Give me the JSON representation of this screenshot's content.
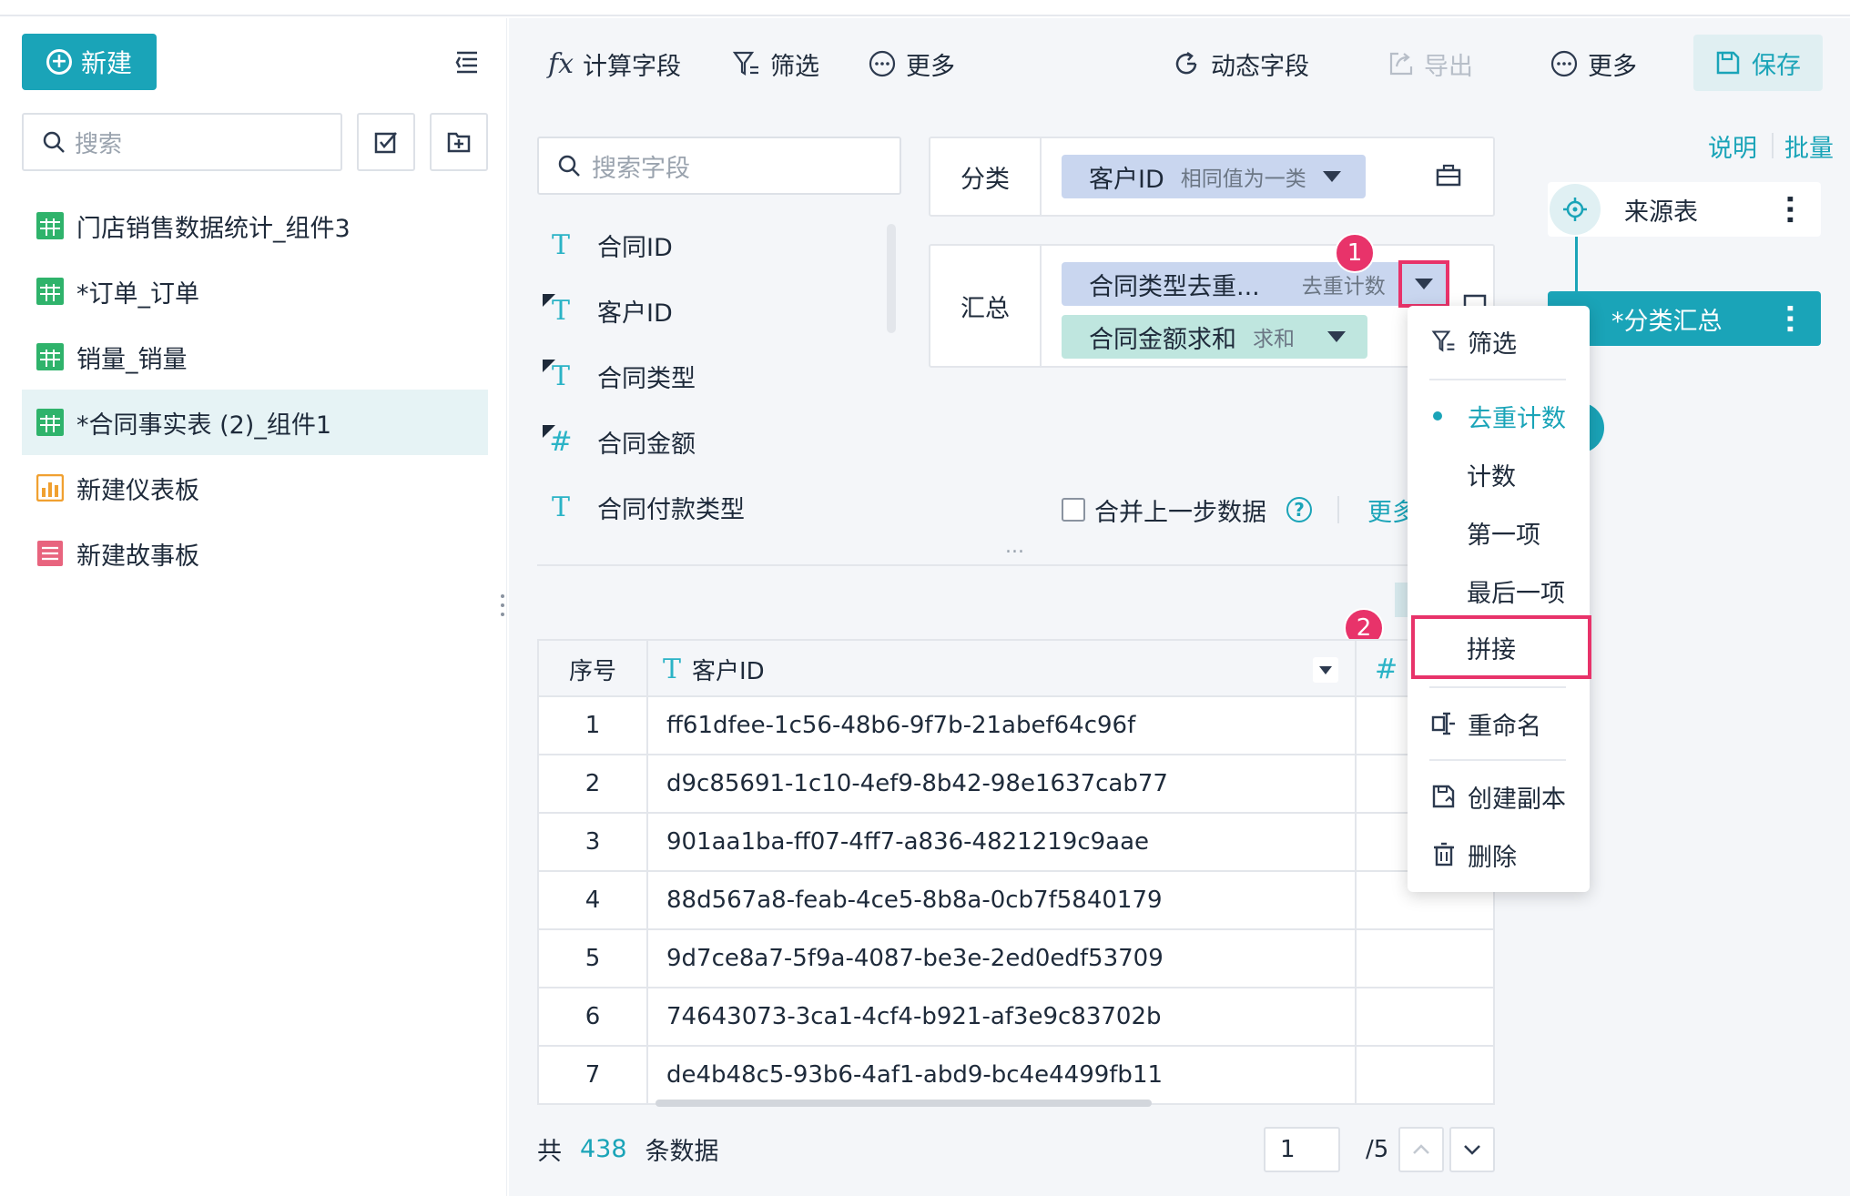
{
  "sidebar": {
    "new_label": "新建",
    "search_placeholder": "搜索",
    "items": [
      {
        "label": "门店销售数据统计_组件3",
        "icon": "table-icon",
        "color": "#2fb36b"
      },
      {
        "label": "*订单_订单",
        "icon": "table-icon",
        "color": "#2fb36b"
      },
      {
        "label": "销量_销量",
        "icon": "table-icon",
        "color": "#2fb36b"
      },
      {
        "label": "*合同事实表 (2)_组件1",
        "icon": "table-icon",
        "color": "#2fb36b"
      },
      {
        "label": "新建仪表板",
        "icon": "dashboard-icon",
        "color": "#f0a030"
      },
      {
        "label": "新建故事板",
        "icon": "story-icon",
        "color": "#e8647e"
      }
    ]
  },
  "toolbar": {
    "calc_field": "计算字段",
    "filter": "筛选",
    "more_left": "更多",
    "dynamic_field": "动态字段",
    "export": "导出",
    "more_right": "更多",
    "save": "保存"
  },
  "fields": {
    "search_placeholder": "搜索字段",
    "items": [
      {
        "label": "合同ID",
        "type": "T"
      },
      {
        "label": "客户ID",
        "type": "T"
      },
      {
        "label": "合同类型",
        "type": "T"
      },
      {
        "label": "合同金额",
        "type": "#"
      },
      {
        "label": "合同付款类型",
        "type": "T"
      }
    ]
  },
  "config": {
    "category_label": "分类",
    "category_pill": {
      "name": "客户ID",
      "sub": "相同值为一类"
    },
    "summary_label": "汇总",
    "summary_pills": [
      {
        "name": "合同类型去重...",
        "sub": "去重计数"
      },
      {
        "name": "合同金额求和",
        "sub": "求和"
      }
    ],
    "merge_prev": "合并上一步数据",
    "more_link": "更多",
    "badge1": "1",
    "badge2": "2",
    "ellipsis": "..."
  },
  "table": {
    "headers": [
      "序号",
      "客户ID",
      "#"
    ],
    "rows": [
      [
        "1",
        "ff61dfee-1c56-48b6-9f7b-21abef64c96f"
      ],
      [
        "2",
        "d9c85691-1c10-4ef9-8b42-98e1637cab77"
      ],
      [
        "3",
        "901aa1ba-ff07-4ff7-a836-4821219c9aae"
      ],
      [
        "4",
        "88d567a8-feab-4ce5-8b8a-0cb7f5840179"
      ],
      [
        "5",
        "9d7ce8a7-5f9a-4087-be3e-2ed0edf53709"
      ],
      [
        "6",
        "74643073-3ca1-4cf4-b921-af3e9c83702b"
      ],
      [
        "7",
        "de4b48c5-93b6-4af1-abd9-bc4e4499fb11"
      ]
    ]
  },
  "footer": {
    "prefix": "共",
    "count": "438",
    "suffix": "条数据",
    "page": "1",
    "total_pages": "/5"
  },
  "right": {
    "explain": "说明",
    "batch": "批量",
    "node_source": "来源表",
    "node_summary": "*分类汇总"
  },
  "dropdown": {
    "filter": "筛选",
    "distinct_count": "去重计数",
    "count": "计数",
    "first": "第一项",
    "last": "最后一项",
    "concat": "拼接",
    "rename": "重命名",
    "copy": "创建副本",
    "delete": "删除"
  },
  "colors": {
    "accent": "#1aa4b8",
    "highlight": "#e8336a",
    "pill_blue": "#c9d6ef",
    "pill_green": "#bfe6df"
  }
}
